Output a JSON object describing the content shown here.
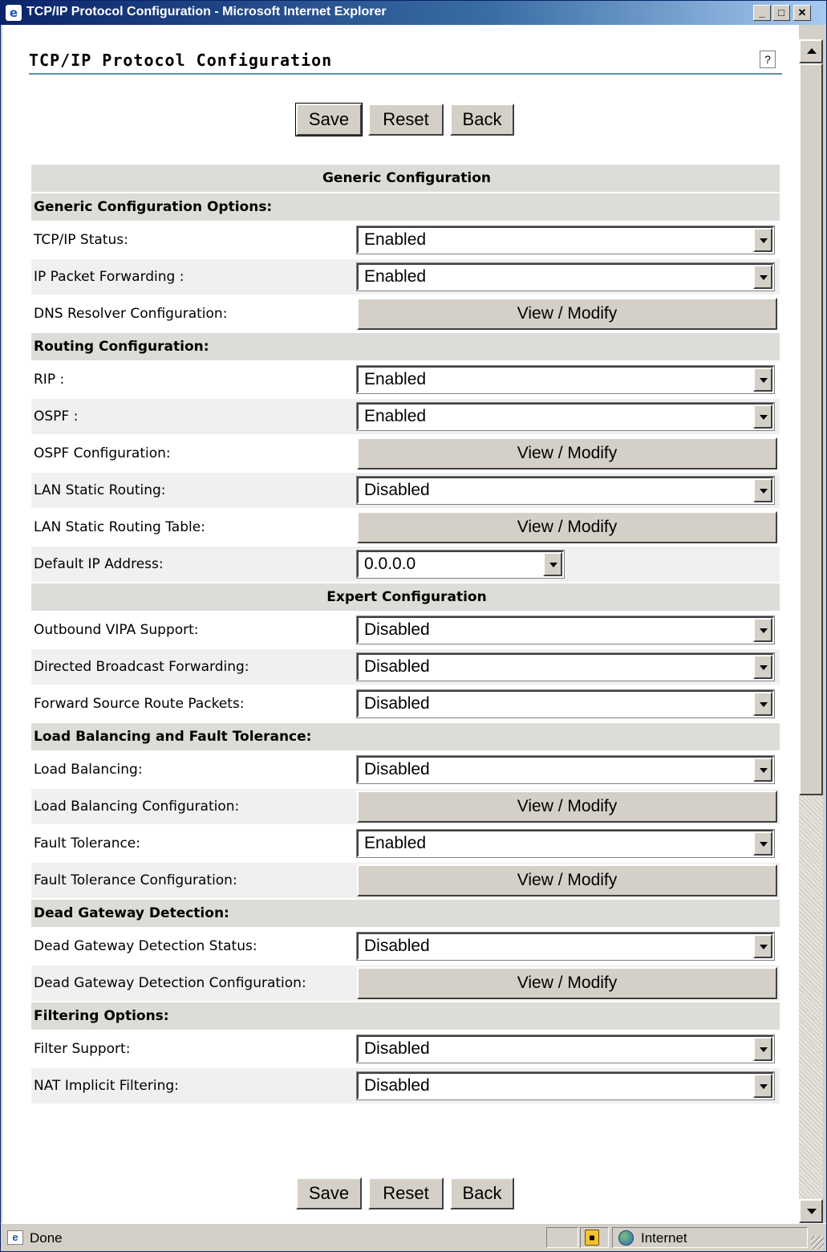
{
  "window": {
    "title": "TCP/IP Protocol Configuration - Microsoft Internet Explorer",
    "minimize": "_",
    "maximize": "□",
    "close": "✕"
  },
  "page": {
    "title": "TCP/IP Protocol Configuration",
    "help": "?"
  },
  "buttons": {
    "save": "Save",
    "reset": "Reset",
    "back": "Back"
  },
  "view_modify": "View / Modify",
  "generic": {
    "header": "Generic Configuration",
    "options_header": "Generic Configuration Options:",
    "tcpip_status": {
      "label": "TCP/IP Status:",
      "value": "Enabled"
    },
    "ip_forwarding": {
      "label": "IP Packet Forwarding :",
      "value": "Enabled"
    },
    "dns_resolver": {
      "label": "DNS Resolver Configuration:"
    }
  },
  "routing": {
    "header": "Routing Configuration:",
    "rip": {
      "label": "RIP :",
      "value": "Enabled"
    },
    "ospf": {
      "label": "OSPF :",
      "value": "Enabled"
    },
    "ospf_config": {
      "label": "OSPF Configuration:"
    },
    "lan_static": {
      "label": "LAN Static Routing:",
      "value": "Disabled"
    },
    "lan_static_table": {
      "label": "LAN Static Routing Table:"
    },
    "default_ip": {
      "label": "Default IP Address:",
      "value": "0.0.0.0"
    }
  },
  "expert": {
    "header": "Expert Configuration",
    "outbound_vipa": {
      "label": "Outbound VIPA Support:",
      "value": "Disabled"
    },
    "directed_broadcast": {
      "label": "Directed Broadcast Forwarding:",
      "value": "Disabled"
    },
    "source_route": {
      "label": "Forward Source Route Packets:",
      "value": "Disabled"
    }
  },
  "load_balancing": {
    "header": "Load Balancing and Fault Tolerance:",
    "lb": {
      "label": "Load Balancing:",
      "value": "Disabled"
    },
    "lb_config": {
      "label": "Load Balancing Configuration:"
    },
    "ft": {
      "label": "Fault Tolerance:",
      "value": "Enabled"
    },
    "ft_config": {
      "label": "Fault Tolerance Configuration:"
    }
  },
  "dead_gateway": {
    "header": "Dead Gateway Detection:",
    "status": {
      "label": "Dead Gateway Detection Status:",
      "value": "Disabled"
    },
    "config": {
      "label": "Dead Gateway Detection Configuration:"
    }
  },
  "filtering": {
    "header": "Filtering Options:",
    "filter_support": {
      "label": "Filter Support:",
      "value": "Disabled"
    },
    "nat_filtering": {
      "label": "NAT Implicit Filtering:",
      "value": "Disabled"
    }
  },
  "statusbar": {
    "status": "Done",
    "zone": "Internet"
  },
  "icons": {
    "window": "ie-icon",
    "help": "help-icon",
    "status": "page-done-icon",
    "lock": "lock-icon",
    "zone": "internet-globe-icon"
  }
}
